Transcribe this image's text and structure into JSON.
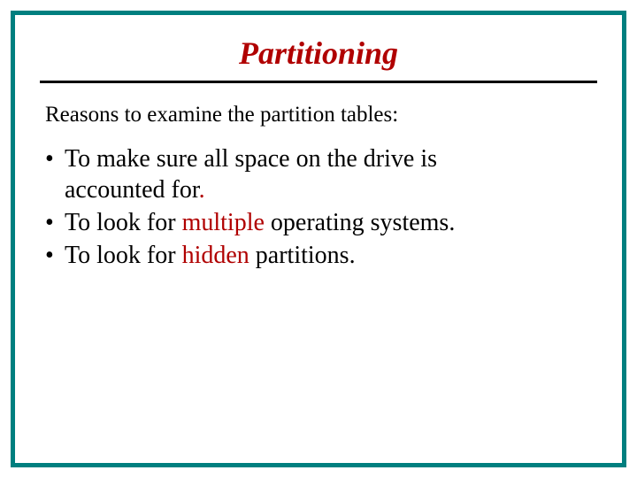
{
  "title": "Partitioning",
  "intro": "Reasons to examine the partition tables:",
  "bullets": {
    "b1a": "To make sure all space on the drive is",
    "b1b": "accounted for",
    "b1c": ".",
    "b2a": "To look for ",
    "b2b": "multiple",
    "b2c": " operating systems.",
    "b3a": "To look for ",
    "b3b": "hidden",
    "b3c": " partitions."
  }
}
